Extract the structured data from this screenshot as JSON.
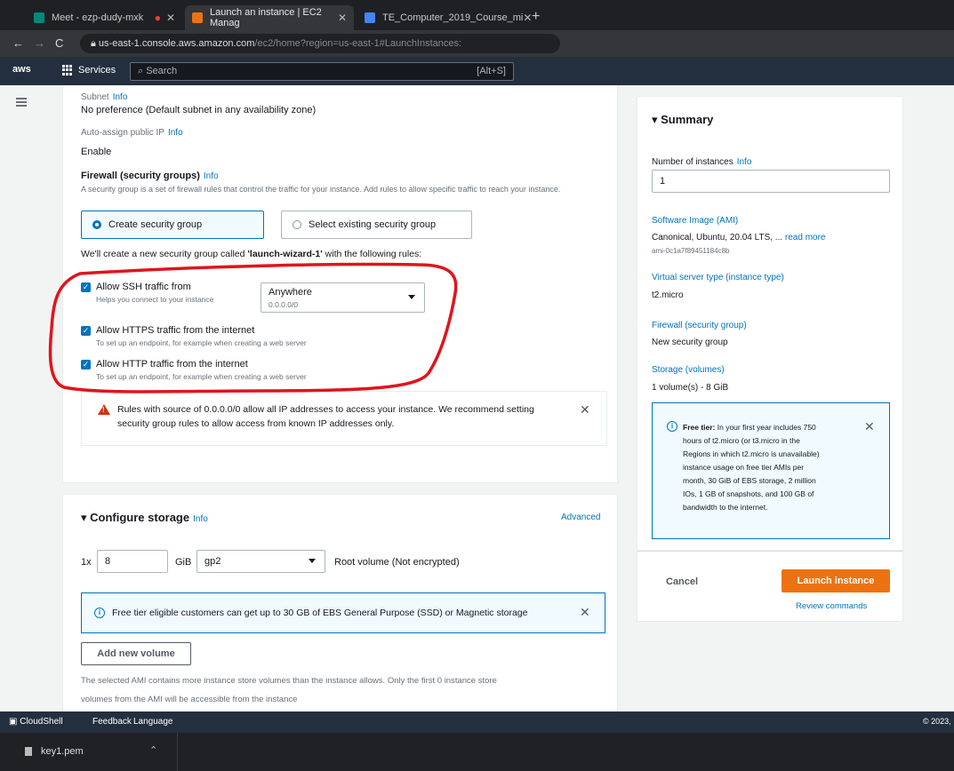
{
  "browser": {
    "tabs": [
      {
        "title": "Meet - ezp-dudy-mxk",
        "active": false
      },
      {
        "title": "Launch an instance | EC2 Manag",
        "active": true
      },
      {
        "title": "TE_Computer_2019_Course_mi",
        "active": false
      }
    ],
    "url_host": "us-east-1.console.aws.amazon.com",
    "url_path": "/ec2/home?region=us-east-1#LaunchInstances:"
  },
  "aws_header": {
    "logo": "aws",
    "services_label": "Services",
    "search_placeholder": "Search",
    "search_shortcut": "[Alt+S]"
  },
  "network": {
    "subnet_label": "Subnet",
    "subnet_info": "Info",
    "subnet_value": "No preference (Default subnet in any availability zone)",
    "auto_ip_label": "Auto-assign public IP",
    "auto_ip_info": "Info",
    "auto_ip_value": "Enable",
    "firewall_label": "Firewall (security groups)",
    "firewall_info": "Info",
    "firewall_desc": "A security group is a set of firewall rules that control the traffic for your instance. Add rules to allow specific traffic to reach your instance.",
    "option_create": "Create security group",
    "option_select": "Select existing security group",
    "sg_sentence_pre": "We'll create a new security group called ",
    "sg_name": "'launch-wizard-1'",
    "sg_sentence_post": " with the following rules:",
    "ssh_label": "Allow SSH traffic from",
    "ssh_help": "Helps you connect to your instance",
    "ssh_source": "Anywhere",
    "ssh_source_cidr": "0.0.0.0/0",
    "https_label": "Allow HTTPS traffic from the internet",
    "https_help": "To set up an endpoint, for example when creating a web server",
    "http_label": "Allow HTTP traffic from the internet",
    "http_help": "To set up an endpoint, for example when creating a web server",
    "warning_line1": "Rules with source of 0.0.0.0/0 allow all IP addresses to access your instance. We recommend setting",
    "warning_line2": "security group rules to allow access from known IP addresses only."
  },
  "storage": {
    "title": "Configure storage",
    "info": "Info",
    "advanced": "Advanced",
    "count_prefix": "1x",
    "size": "8",
    "unit": "GiB",
    "volume_type": "gp2",
    "root_note": "Root volume  (Not encrypted)",
    "free_tier_note": "Free tier eligible customers can get up to 30 GB of EBS General Purpose (SSD) or Magnetic storage",
    "add_volume": "Add new volume",
    "ami_note_line1": "The selected AMI contains more instance store volumes than the instance allows. Only the first 0 instance store",
    "ami_note_line2": "volumes from the AMI will be accessible from the instance"
  },
  "summary": {
    "title": "Summary",
    "num_instances_label": "Number of instances",
    "num_instances_info": "Info",
    "num_instances": "1",
    "software_image_label": "Software Image (AMI)",
    "software_image_value": "Canonical, Ubuntu, 20.04 LTS, ...",
    "software_image_more": "read more",
    "ami_id": "ami-0c1a7f89451184c8b",
    "instance_type_label": "Virtual server type (instance type)",
    "instance_type_value": "t2.micro",
    "firewall_label": "Firewall (security group)",
    "firewall_value": "New security group",
    "storage_label": "Storage (volumes)",
    "storage_value": "1 volume(s) - 8 GiB",
    "free_tier_title": "Free tier:",
    "free_tier_lines": [
      "In your first year includes 750",
      "hours of t2.micro (or t3.micro in the",
      "Regions in which t2.micro is unavailable)",
      "instance usage on free tier AMIs per",
      "month, 30 GiB of EBS storage, 2 million",
      "IOs, 1 GB of snapshots, and 100 GB of",
      "bandwidth to the internet."
    ],
    "cancel": "Cancel",
    "launch": "Launch instance",
    "review": "Review commands"
  },
  "footer": {
    "cloudshell": "CloudShell",
    "feedback": "Feedback",
    "language": "Language",
    "copyright": "© 2023,"
  },
  "downloads": {
    "file": "key1.pem"
  },
  "colors": {
    "aws_nav": "#232f3e",
    "link_blue": "#0073bb",
    "launch_orange": "#ec7211",
    "annotation_red": "#e0141e",
    "warning_red": "#d13212"
  }
}
